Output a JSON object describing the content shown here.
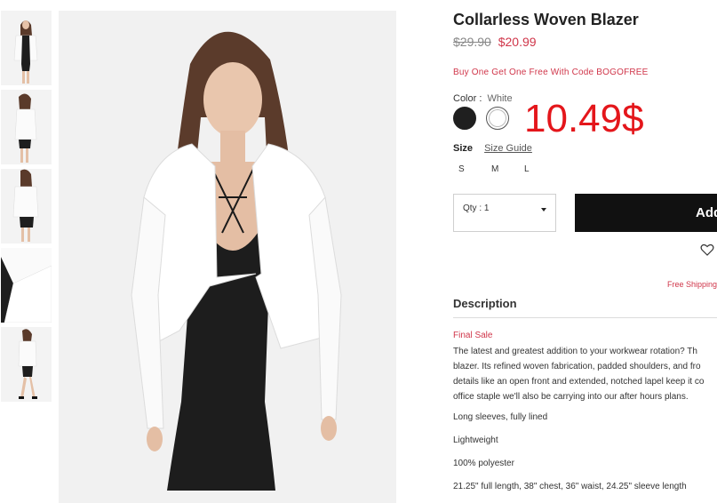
{
  "product": {
    "title": "Collarless Woven Blazer",
    "old_price": "$29.90",
    "new_price": "$20.99",
    "promo": "Buy One Get One Free With Code BOGOFREE",
    "overlay_price": "10.49$"
  },
  "color": {
    "label": "Color :",
    "value": "White",
    "options": [
      "black",
      "white"
    ]
  },
  "size": {
    "label": "Size",
    "guide": "Size Guide",
    "options": [
      "S",
      "M",
      "L"
    ]
  },
  "cart": {
    "qty_label": "Qty : 1",
    "add_label": "Add",
    "free_shipping": "Free Shipping"
  },
  "description": {
    "title": "Description",
    "final_sale": "Final Sale",
    "lines": [
      "The latest and greatest addition to your workwear rotation? Th",
      "blazer. Its refined woven fabrication, padded shoulders, and fro",
      "details like an open front and extended, notched lapel keep it co",
      "office staple we'll also be carrying into our after hours plans."
    ],
    "bullets": [
      "Long sleeves, fully lined",
      "Lightweight",
      "100% polyester",
      "21.25\" full length, 38\" chest, 36\" waist, 24.25\" sleeve length"
    ]
  },
  "colors": {
    "accent": "#d0364a",
    "overlay": "#e4161b",
    "button": "#111111"
  }
}
